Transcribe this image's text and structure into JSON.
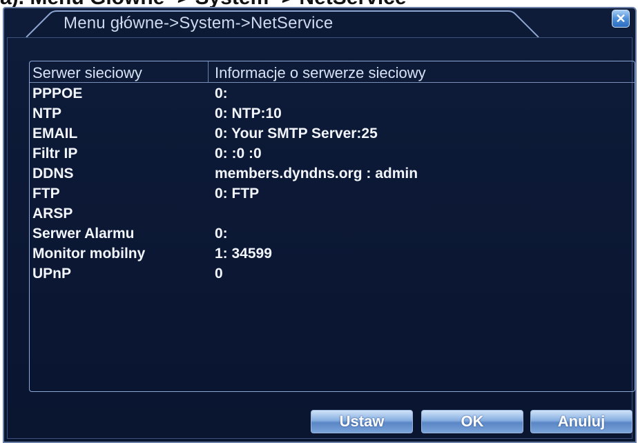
{
  "document": {
    "caption": "a). Menu Główne -> System -> NetService"
  },
  "window": {
    "title": "Menu główne->System->NetService",
    "close_icon": "close-icon",
    "accent_color": "#0e1c3a"
  },
  "table": {
    "headers": [
      "Serwer sieciowy",
      "Informacje o serwerze sieciowy"
    ],
    "rows": [
      {
        "name": "PPPOE",
        "info": "0:"
      },
      {
        "name": "NTP",
        "info": "0: NTP:10"
      },
      {
        "name": "EMAIL",
        "info": "0: Your SMTP Server:25"
      },
      {
        "name": "Filtr IP",
        "info": "0: :0 :0"
      },
      {
        "name": "DDNS",
        "info": "members.dyndns.org : admin"
      },
      {
        "name": "FTP",
        "info": "0: FTP"
      },
      {
        "name": "ARSP",
        "info": ""
      },
      {
        "name": "Serwer Alarmu",
        "info": "0:"
      },
      {
        "name": "Monitor mobilny",
        "info": "1: 34599"
      },
      {
        "name": "UPnP",
        "info": "0"
      }
    ]
  },
  "buttons": {
    "set": "Ustaw",
    "ok": "OK",
    "cancel": "Anuluj"
  }
}
